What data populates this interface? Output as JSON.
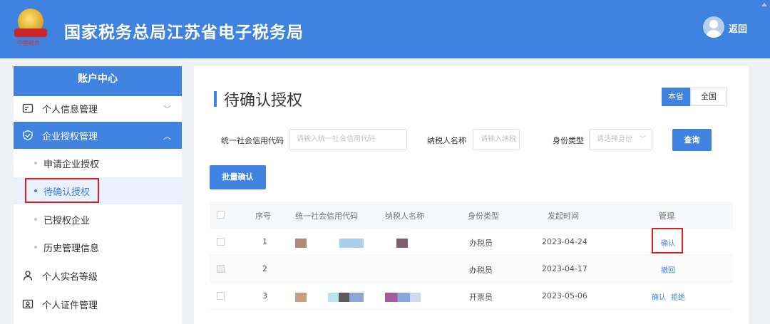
{
  "header": {
    "site_title": "国家税务总局江苏省电子税务局",
    "back_label": "返回",
    "logo_text": "中国税务",
    "colors": {
      "brand": "#3f82e0",
      "highlight": "#e21d1d"
    }
  },
  "sidebar": {
    "title": "账户中心",
    "items": [
      {
        "label": "个人信息管理",
        "icon": "id-card-icon",
        "chevron": "﹀"
      },
      {
        "label": "企业授权管理",
        "icon": "shield-check-icon",
        "chevron": "︿"
      },
      {
        "label": "申请企业授权"
      },
      {
        "label": "待确认授权"
      },
      {
        "label": "已授权企业"
      },
      {
        "label": "历史管理信息"
      },
      {
        "label": "个人实名等级",
        "icon": "user-icon"
      },
      {
        "label": "个人证件管理",
        "icon": "certificate-icon"
      }
    ]
  },
  "main": {
    "title": "待确认授权",
    "scope_tabs": [
      "本省",
      "全国"
    ],
    "filters": {
      "credit_code_label": "统一社会信用代码",
      "credit_code_placeholder": "请输入统一社会信用代码",
      "taxpayer_name_label": "纳税人名称",
      "taxpayer_name_placeholder": "请输入纳税",
      "identity_type_label": "身份类型",
      "identity_type_placeholder": "请选择身份"
    },
    "query_button": "查询",
    "batch_button": "批量确认",
    "table": {
      "headers": [
        "序号",
        "统一社会信用代码",
        "纳税人名称",
        "身份类型",
        "发起时间",
        "管理"
      ],
      "rows": [
        {
          "index": "1",
          "identity": "办税员",
          "time": "2023-04-24",
          "actions": [
            "确认"
          ]
        },
        {
          "index": "2",
          "identity": "办税员",
          "time": "2023-04-17",
          "actions": [
            "撤回"
          ]
        },
        {
          "index": "3",
          "identity": "开票员",
          "time": "2023-05-06",
          "actions": [
            "确认",
            "拒绝"
          ]
        }
      ]
    }
  }
}
